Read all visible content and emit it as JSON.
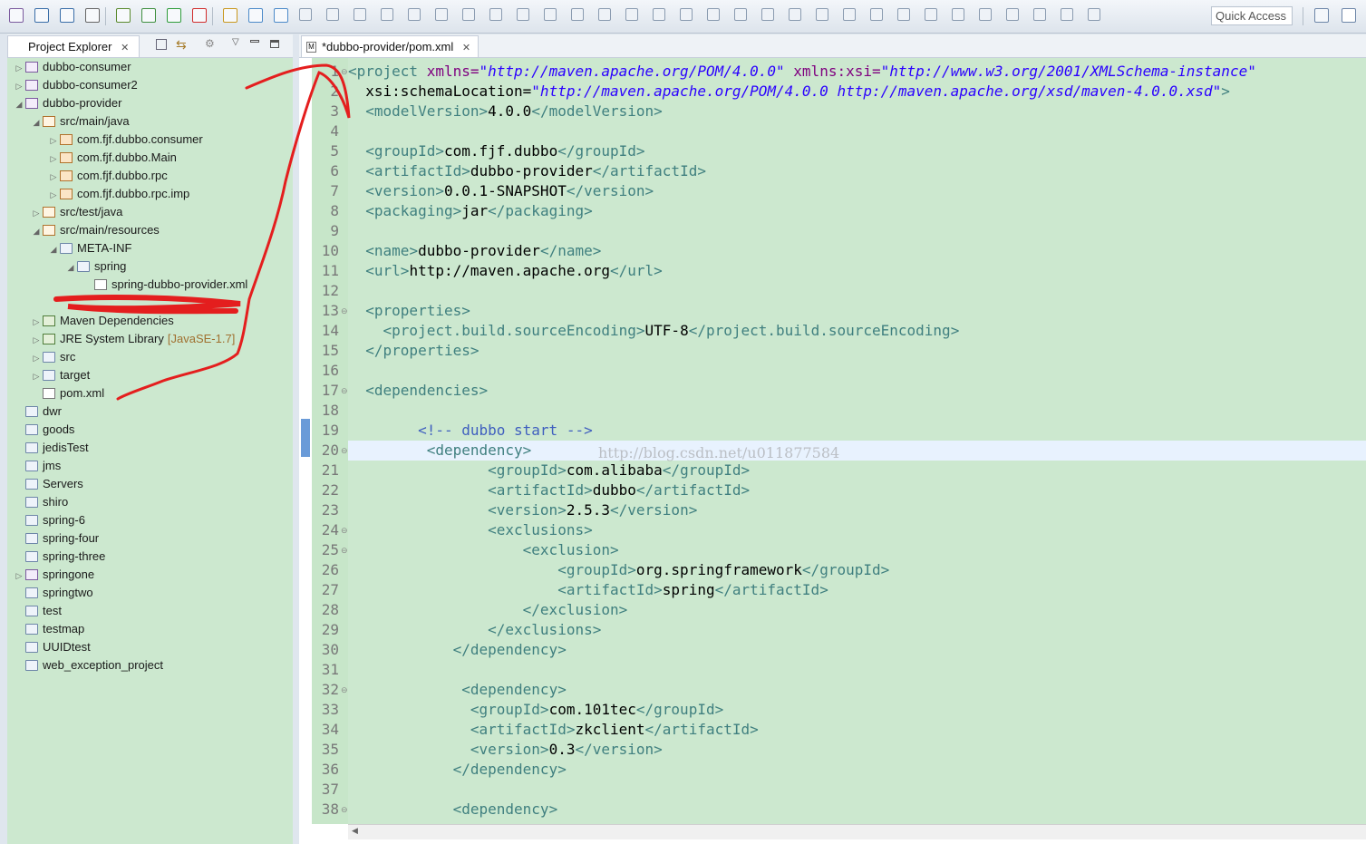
{
  "toolbar": {
    "quick_access": "Quick Access",
    "icons": [
      "new-icon",
      "save-icon",
      "save-all-icon",
      "print-icon",
      "build-icon",
      "debug-icon",
      "run-icon",
      "stop-icon",
      "search-icon",
      "open-type-icon",
      "perspective-icon"
    ]
  },
  "explorer": {
    "title": "Project Explorer",
    "tree": [
      {
        "label": "dubbo-consumer",
        "depth": 0,
        "arrow": "▷",
        "icon": "proj"
      },
      {
        "label": "dubbo-consumer2",
        "depth": 0,
        "arrow": "▷",
        "icon": "proj"
      },
      {
        "label": "dubbo-provider",
        "depth": 0,
        "arrow": "◢",
        "icon": "proj"
      },
      {
        "label": "src/main/java",
        "depth": 1,
        "arrow": "◢",
        "icon": "srcf"
      },
      {
        "label": "com.fjf.dubbo.consumer",
        "depth": 2,
        "arrow": "▷",
        "icon": "pkg"
      },
      {
        "label": "com.fjf.dubbo.Main",
        "depth": 2,
        "arrow": "▷",
        "icon": "pkg"
      },
      {
        "label": "com.fjf.dubbo.rpc",
        "depth": 2,
        "arrow": "▷",
        "icon": "pkg"
      },
      {
        "label": "com.fjf.dubbo.rpc.imp",
        "depth": 2,
        "arrow": "▷",
        "icon": "pkg"
      },
      {
        "label": "src/test/java",
        "depth": 1,
        "arrow": "▷",
        "icon": "srcf"
      },
      {
        "label": "src/main/resources",
        "depth": 1,
        "arrow": "◢",
        "icon": "srcf"
      },
      {
        "label": "META-INF",
        "depth": 2,
        "arrow": "◢",
        "icon": "folder"
      },
      {
        "label": "spring",
        "depth": 3,
        "arrow": "◢",
        "icon": "folder"
      },
      {
        "label": "spring-dubbo-provider.xml",
        "depth": 4,
        "arrow": "",
        "icon": "xml"
      },
      {
        "label": "",
        "depth": 1,
        "arrow": "",
        "icon": ""
      },
      {
        "label": "Maven Dependencies",
        "depth": 1,
        "arrow": "▷",
        "icon": "lib"
      },
      {
        "label": "JRE System Library",
        "decor": "[JavaSE-1.7]",
        "depth": 1,
        "arrow": "▷",
        "icon": "lib"
      },
      {
        "label": "src",
        "depth": 1,
        "arrow": "▷",
        "icon": "folder"
      },
      {
        "label": "target",
        "depth": 1,
        "arrow": "▷",
        "icon": "folder"
      },
      {
        "label": "pom.xml",
        "depth": 1,
        "arrow": "",
        "icon": "xml"
      },
      {
        "label": "dwr",
        "depth": 0,
        "arrow": "",
        "icon": "folder"
      },
      {
        "label": "goods",
        "depth": 0,
        "arrow": "",
        "icon": "folder"
      },
      {
        "label": "jedisTest",
        "depth": 0,
        "arrow": "",
        "icon": "folder"
      },
      {
        "label": "jms",
        "depth": 0,
        "arrow": "",
        "icon": "folder"
      },
      {
        "label": "Servers",
        "depth": 0,
        "arrow": "",
        "icon": "folder"
      },
      {
        "label": "shiro",
        "depth": 0,
        "arrow": "",
        "icon": "folder"
      },
      {
        "label": "spring-6",
        "depth": 0,
        "arrow": "",
        "icon": "folder"
      },
      {
        "label": "spring-four",
        "depth": 0,
        "arrow": "",
        "icon": "folder"
      },
      {
        "label": "spring-three",
        "depth": 0,
        "arrow": "",
        "icon": "folder"
      },
      {
        "label": "springone",
        "depth": 0,
        "arrow": "▷",
        "icon": "proj"
      },
      {
        "label": "springtwo",
        "depth": 0,
        "arrow": "",
        "icon": "folder"
      },
      {
        "label": "test",
        "depth": 0,
        "arrow": "",
        "icon": "folder"
      },
      {
        "label": "testmap",
        "depth": 0,
        "arrow": "",
        "icon": "folder"
      },
      {
        "label": "UUIDtest",
        "depth": 0,
        "arrow": "",
        "icon": "folder"
      },
      {
        "label": "web_exception_project",
        "depth": 0,
        "arrow": "",
        "icon": "folder"
      }
    ]
  },
  "editor": {
    "tab_title": "*dubbo-provider/pom.xml",
    "watermark": "http://blog.csdn.net/u011877584",
    "lines": [
      {
        "n": "1",
        "fold": "⊖",
        "text": "<project xmlns=\"http://maven.apache.org/POM/4.0.0\" xmlns:xsi=\"http://www.w3.org/2001/XMLSchema-instance\""
      },
      {
        "n": "2",
        "text": "  xsi:schemaLocation=\"http://maven.apache.org/POM/4.0.0 http://maven.apache.org/xsd/maven-4.0.0.xsd\">"
      },
      {
        "n": "3",
        "text": "  <modelVersion>4.0.0</modelVersion>"
      },
      {
        "n": "4",
        "text": ""
      },
      {
        "n": "5",
        "text": "  <groupId>com.fjf.dubbo</groupId>"
      },
      {
        "n": "6",
        "text": "  <artifactId>dubbo-provider</artifactId>"
      },
      {
        "n": "7",
        "text": "  <version>0.0.1-SNAPSHOT</version>"
      },
      {
        "n": "8",
        "text": "  <packaging>jar</packaging>"
      },
      {
        "n": "9",
        "text": ""
      },
      {
        "n": "10",
        "text": "  <name>dubbo-provider</name>"
      },
      {
        "n": "11",
        "text": "  <url>http://maven.apache.org</url>"
      },
      {
        "n": "12",
        "text": ""
      },
      {
        "n": "13",
        "fold": "⊖",
        "text": "  <properties>"
      },
      {
        "n": "14",
        "text": "    <project.build.sourceEncoding>UTF-8</project.build.sourceEncoding>"
      },
      {
        "n": "15",
        "text": "  </properties>"
      },
      {
        "n": "16",
        "text": ""
      },
      {
        "n": "17",
        "fold": "⊖",
        "text": "  <dependencies>"
      },
      {
        "n": "18",
        "text": ""
      },
      {
        "n": "19",
        "text": "        <!-- dubbo start -->"
      },
      {
        "n": "20",
        "fold": "⊖",
        "text": "         <dependency>"
      },
      {
        "n": "21",
        "text": "                <groupId>com.alibaba</groupId>"
      },
      {
        "n": "22",
        "text": "                <artifactId>dubbo</artifactId>"
      },
      {
        "n": "23",
        "text": "                <version>2.5.3</version>"
      },
      {
        "n": "24",
        "fold": "⊖",
        "text": "                <exclusions>"
      },
      {
        "n": "25",
        "fold": "⊖",
        "text": "                    <exclusion>"
      },
      {
        "n": "26",
        "text": "                        <groupId>org.springframework</groupId>"
      },
      {
        "n": "27",
        "text": "                        <artifactId>spring</artifactId>"
      },
      {
        "n": "28",
        "text": "                    </exclusion>"
      },
      {
        "n": "29",
        "text": "                </exclusions>"
      },
      {
        "n": "30",
        "text": "            </dependency>"
      },
      {
        "n": "31",
        "text": ""
      },
      {
        "n": "32",
        "fold": "⊖",
        "text": "             <dependency>"
      },
      {
        "n": "33",
        "text": "              <groupId>com.101tec</groupId>"
      },
      {
        "n": "34",
        "text": "              <artifactId>zkclient</artifactId>"
      },
      {
        "n": "35",
        "text": "              <version>0.3</version>"
      },
      {
        "n": "36",
        "text": "            </dependency>"
      },
      {
        "n": "37",
        "text": ""
      },
      {
        "n": "38",
        "fold": "⊖",
        "text": "            <dependency>"
      }
    ]
  }
}
